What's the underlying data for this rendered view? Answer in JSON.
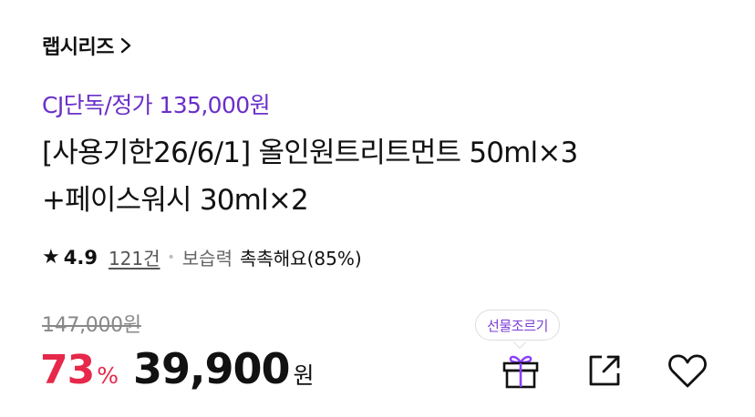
{
  "brand": {
    "name": "랩시리즈",
    "chevron": "chevron-right-icon"
  },
  "promo_text": "CJ단독/정가 135,000원",
  "product": {
    "title_line1": "[사용기한26/6/1] 올인원트리트먼트 50ml×3",
    "title_line2": "+페이스워시 30ml×2"
  },
  "rating": {
    "star_icon": "star-icon",
    "score": "4.9",
    "review_count": "121건",
    "attribute_label": "보습력",
    "attribute_value": "촉촉해요(85%)"
  },
  "pricing": {
    "original_price": "147,000원",
    "discount_rate": "73",
    "discount_unit": "%",
    "sale_price": "39,900",
    "currency": "원"
  },
  "actions": {
    "gift_tooltip": "선물조르기",
    "gift_icon": "gift-icon",
    "share_icon": "share-icon",
    "wishlist_icon": "heart-icon"
  },
  "colors": {
    "promo": "#6a2fc9",
    "discount": "#e6284a",
    "gift_accent": "#8a3ffc"
  }
}
